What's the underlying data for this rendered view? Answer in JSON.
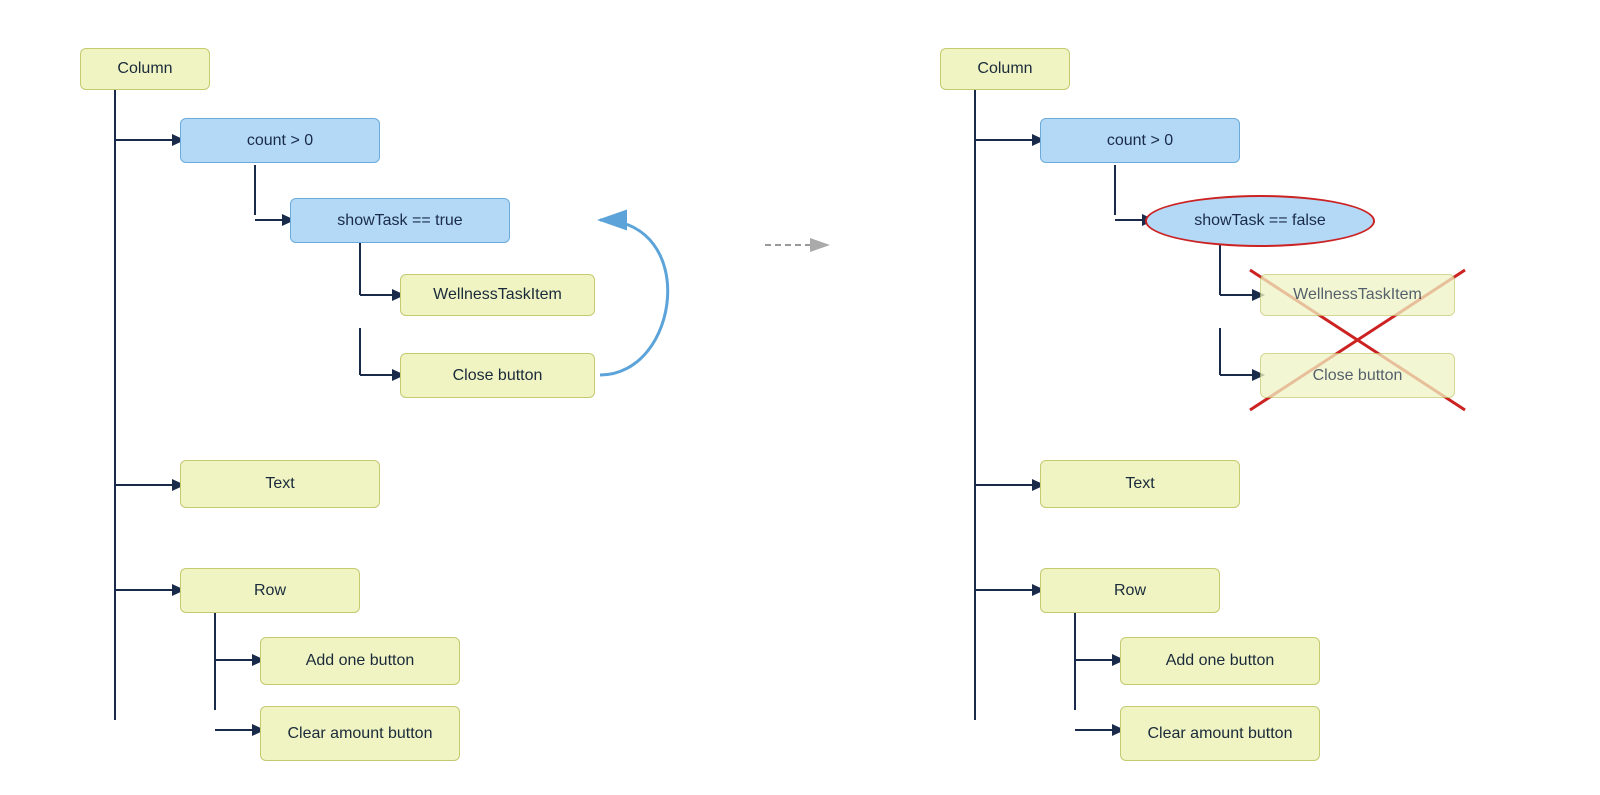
{
  "left": {
    "title": "Column",
    "nodes": {
      "count": "count > 0",
      "showTask": "showTask == true",
      "wellnessTaskItem": "WellnessTaskItem",
      "closeButton": "Close button",
      "text": "Text",
      "row": "Row",
      "addOne": "Add one button",
      "clearAmount": "Clear amount button"
    }
  },
  "right": {
    "title": "Column",
    "nodes": {
      "count": "count > 0",
      "showTask": "showTask == false",
      "wellnessTaskItem": "WellnessTaskItem",
      "closeButton": "Close button",
      "text": "Text",
      "row": "Row",
      "addOne": "Add one button",
      "clearAmount": "Clear amount button"
    }
  },
  "arrow": {
    "dots": [
      "·",
      "·",
      "·"
    ],
    "arrowSymbol": "▶"
  }
}
